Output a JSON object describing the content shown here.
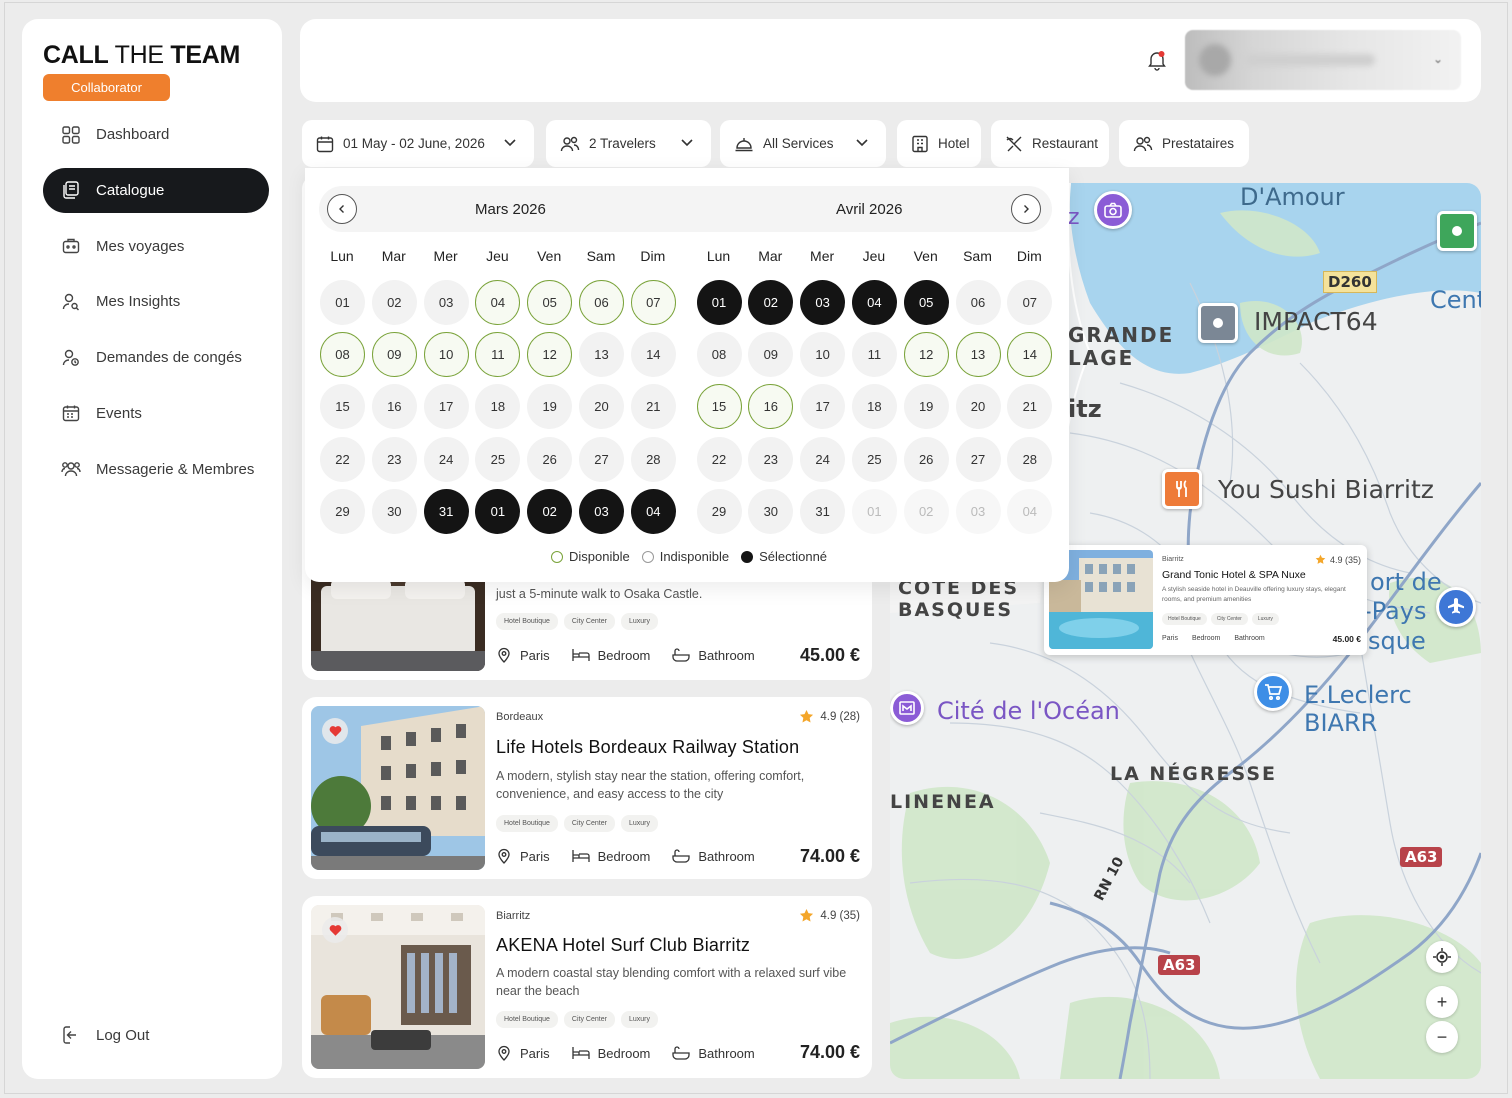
{
  "sidebar": {
    "brand_bold": "CALL",
    "brand_light": "THE",
    "brand_bold2": "TEAM",
    "role_badge": "Collaborator",
    "items": [
      {
        "label": "Dashboard",
        "icon": "grid-icon"
      },
      {
        "label": "Catalogue",
        "icon": "catalogue-icon",
        "active": true
      },
      {
        "label": "Mes voyages",
        "icon": "suitcase-icon"
      },
      {
        "label": "Mes Insights",
        "icon": "user-search-icon"
      },
      {
        "label": "Demandes de congés",
        "icon": "user-clock-icon"
      },
      {
        "label": "Events",
        "icon": "calendar-icon"
      },
      {
        "label": "Messagerie & Membres",
        "icon": "users-icon"
      }
    ],
    "logout": "Log Out"
  },
  "filters": {
    "dates": "01 May - 02 June, 2026",
    "travelers": "2 Travelers",
    "services": "All Services",
    "hotel": "Hotel",
    "restaurant": "Restaurant",
    "prestataires": "Prestataires"
  },
  "calendar": {
    "left_month": "Mars 2026",
    "right_month": "Avril 2026",
    "weekdays": [
      "Lun",
      "Mar",
      "Mer",
      "Jeu",
      "Ven",
      "Sam",
      "Dim"
    ],
    "left_weeks": [
      [
        [
          "01",
          "n"
        ],
        [
          "02",
          "n"
        ],
        [
          "03",
          "n"
        ],
        [
          "04",
          "a"
        ],
        [
          "05",
          "a"
        ],
        [
          "06",
          "a"
        ],
        [
          "07",
          "a"
        ]
      ],
      [
        [
          "08",
          "a"
        ],
        [
          "09",
          "a"
        ],
        [
          "10",
          "a"
        ],
        [
          "11",
          "a"
        ],
        [
          "12",
          "a"
        ],
        [
          "13",
          "n"
        ],
        [
          "14",
          "n"
        ]
      ],
      [
        [
          "15",
          "n"
        ],
        [
          "16",
          "n"
        ],
        [
          "17",
          "n"
        ],
        [
          "18",
          "n"
        ],
        [
          "19",
          "n"
        ],
        [
          "20",
          "n"
        ],
        [
          "21",
          "n"
        ]
      ],
      [
        [
          "22",
          "n"
        ],
        [
          "23",
          "n"
        ],
        [
          "24",
          "n"
        ],
        [
          "25",
          "n"
        ],
        [
          "26",
          "n"
        ],
        [
          "27",
          "n"
        ],
        [
          "28",
          "n"
        ]
      ],
      [
        [
          "29",
          "n"
        ],
        [
          "30",
          "n"
        ],
        [
          "31",
          "s"
        ],
        [
          "01",
          "s"
        ],
        [
          "02",
          "s"
        ],
        [
          "03",
          "s"
        ],
        [
          "04",
          "s"
        ]
      ]
    ],
    "right_weeks": [
      [
        [
          "01",
          "s"
        ],
        [
          "02",
          "s"
        ],
        [
          "03",
          "s"
        ],
        [
          "04",
          "s"
        ],
        [
          "05",
          "s"
        ],
        [
          "06",
          "n"
        ],
        [
          "07",
          "n"
        ]
      ],
      [
        [
          "08",
          "n"
        ],
        [
          "09",
          "n"
        ],
        [
          "10",
          "n"
        ],
        [
          "11",
          "n"
        ],
        [
          "12",
          "a"
        ],
        [
          "13",
          "a"
        ],
        [
          "14",
          "a"
        ]
      ],
      [
        [
          "15",
          "a"
        ],
        [
          "16",
          "a"
        ],
        [
          "17",
          "n"
        ],
        [
          "18",
          "n"
        ],
        [
          "19",
          "n"
        ],
        [
          "20",
          "n"
        ],
        [
          "21",
          "n"
        ]
      ],
      [
        [
          "22",
          "n"
        ],
        [
          "23",
          "n"
        ],
        [
          "24",
          "n"
        ],
        [
          "25",
          "n"
        ],
        [
          "26",
          "n"
        ],
        [
          "27",
          "n"
        ],
        [
          "28",
          "n"
        ]
      ],
      [
        [
          "29",
          "n"
        ],
        [
          "30",
          "n"
        ],
        [
          "31",
          "n"
        ],
        [
          "01",
          "o"
        ],
        [
          "02",
          "o"
        ],
        [
          "03",
          "o"
        ],
        [
          "04",
          "o"
        ]
      ]
    ],
    "legend": {
      "available": "Disponible",
      "unavailable": "Indisponible",
      "selected": "Sélectionné"
    },
    "colors": {
      "available_border": "#7aa33a",
      "selected": "#141414"
    }
  },
  "cards": [
    {
      "desc": "just a 5-minute walk to Osaka Castle.",
      "tags": [
        "Hotel Boutique",
        "City Center",
        "Luxury"
      ],
      "location": "Paris",
      "bedroom": "Bedroom",
      "bathroom": "Bathroom",
      "price": "45.00 €"
    },
    {
      "city": "Bordeaux",
      "rating": "4.9 (28)",
      "title": "Life Hotels Bordeaux Railway Station",
      "desc": "A modern, stylish stay near the station, offering comfort, convenience, and easy access to the city",
      "tags": [
        "Hotel Boutique",
        "City Center",
        "Luxury"
      ],
      "location": "Paris",
      "bedroom": "Bedroom",
      "bathroom": "Bathroom",
      "price": "74.00 €"
    },
    {
      "city": "Biarritz",
      "rating": "4.9 (35)",
      "title": "AKENA Hotel Surf Club Biarritz",
      "desc": "A modern coastal stay blending comfort with a relaxed surf vibe near the beach",
      "tags": [
        "Hotel Boutique",
        "City Center",
        "Luxury"
      ],
      "location": "Paris",
      "bedroom": "Bedroom",
      "bathroom": "Bathroom",
      "price": "74.00 €"
    }
  ],
  "map": {
    "labels": {
      "damour": "D'Amour",
      "d260": "D260",
      "cent": "Cent",
      "impact": "IMPACT64",
      "grande": "GRANDE",
      "lage": "LAGE",
      "itz": "itz",
      "z": "z",
      "sushi": "You Sushi Biarritz",
      "cote": "COTE DES",
      "basques": "BASQUES",
      "ortde": "ort de",
      "pays": "-Pays",
      "sque": "sque",
      "cite": "Cité de l'Océan",
      "leclerc": "E.Leclerc BIARR",
      "negresse": "LA NÉGRESSE",
      "linenea": "LINENEA",
      "a63a": "A63",
      "a63b": "A63",
      "rn10": "RN 10"
    },
    "zoom_in": "+",
    "zoom_out": "−",
    "popup": {
      "city": "Biarritz",
      "rating": "4.9 (35)",
      "title": "Grand Tonic Hotel & SPA Nuxe",
      "desc": "A stylish seaside hotel in Deauville offering luxury stays, elegant rooms, and premium amenities",
      "tags": [
        "Hotel Boutique",
        "City Center",
        "Luxury"
      ],
      "location": "Paris",
      "bedroom": "Bedroom",
      "bathroom": "Bathroom",
      "price": "45.00 €"
    }
  }
}
